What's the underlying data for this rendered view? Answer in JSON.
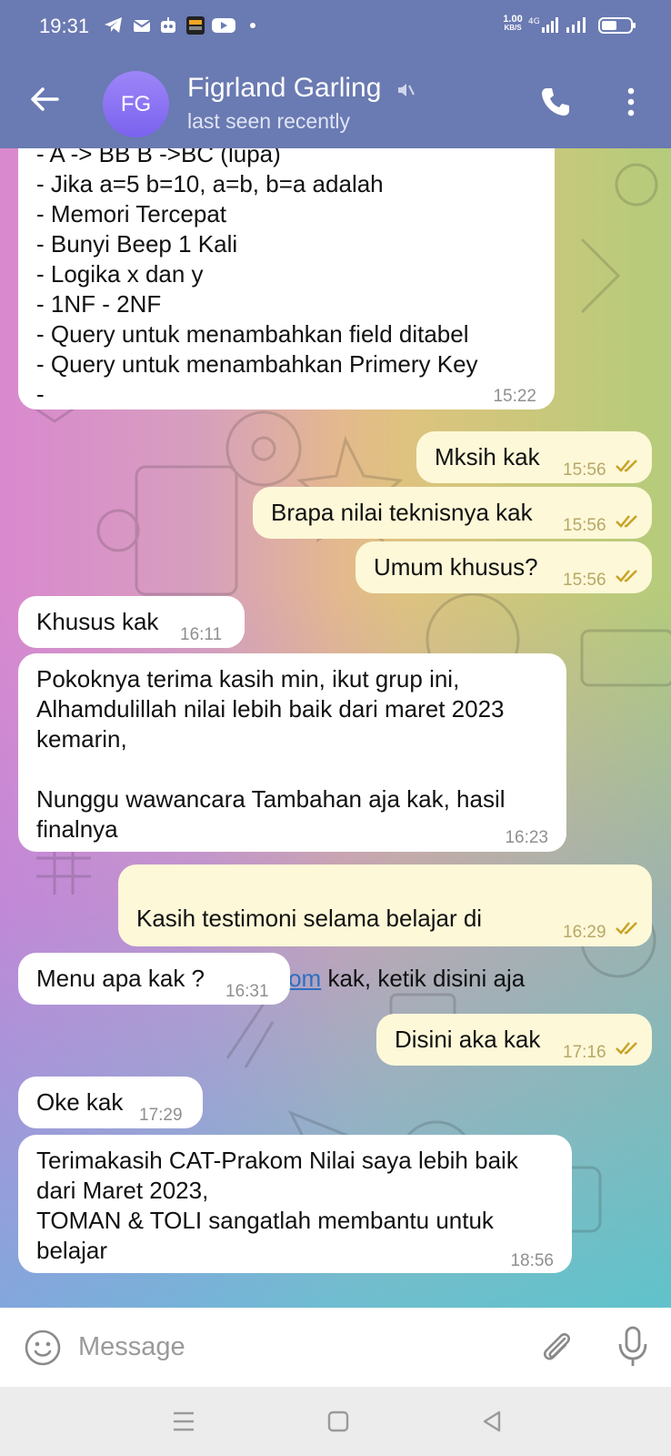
{
  "status_bar": {
    "time": "19:31",
    "net_speed_value": "1.00",
    "net_speed_unit": "KB/S",
    "icons": [
      "telegram-icon",
      "mail-icon",
      "robot-icon",
      "allo-bank-icon",
      "youtube-icon",
      "dot-icon",
      "signal-4g-icon",
      "signal-icon",
      "battery-icon"
    ]
  },
  "header": {
    "avatar_initials": "FG",
    "contact_name": "Figrland Garling",
    "contact_status": "last seen recently",
    "colors": {
      "bar": "#6a7ab2",
      "avatar": "#8b74f4"
    }
  },
  "messages": [
    {
      "direction": "in",
      "text": "- A -> BB B ->BC (lupa)\n- Jika a=5 b=10, a=b, b=a adalah\n- Memori Tercepat\n- Bunyi Beep 1 Kali\n- Logika x dan y\n- 1NF - 2NF\n- Query untuk menambahkan field ditabel\n- Query untuk menambahkan Primery Key\n-",
      "time": "15:22"
    },
    {
      "direction": "out",
      "text": "Mksih kak",
      "time": "15:56"
    },
    {
      "direction": "out",
      "text": "Brapa nilai teknisnya kak",
      "time": "15:56"
    },
    {
      "direction": "out",
      "text": "Umum khusus?",
      "time": "15:56"
    },
    {
      "direction": "in",
      "text": "Khusus kak",
      "time": "16:11"
    },
    {
      "direction": "in",
      "text": "Pokoknya terima kasih min, ikut grup ini,\nAlhamdulillah nilai lebih baik dari maret 2023\nkemarin,\n\nNunggu wawancara Tambahan aja kak, hasil\nfinalnya",
      "time": "16:23"
    },
    {
      "direction": "out",
      "text_line1": "Kasih testimoni selama belajar di",
      "link": "CAT-Prakom.com",
      "text_rest": " kak, ketik disini aja",
      "time": "16:29"
    },
    {
      "direction": "in",
      "text": "Menu apa kak ?",
      "time": "16:31"
    },
    {
      "direction": "out",
      "text": "Disini aka kak",
      "time": "17:16"
    },
    {
      "direction": "in",
      "text": "Oke kak",
      "time": "17:29"
    },
    {
      "direction": "in",
      "text": "Terimakasih CAT-Prakom Nilai saya lebih baik\ndari Maret 2023,\nTOMAN & TOLI sangatlah membantu untuk\nbelajar",
      "time": "18:56"
    }
  ],
  "composer": {
    "placeholder": "Message"
  },
  "colors": {
    "incoming_bubble": "#ffffff",
    "outgoing_bubble": "#fdf8d8",
    "link": "#2d6fc0",
    "read_check": "#c9a227"
  }
}
